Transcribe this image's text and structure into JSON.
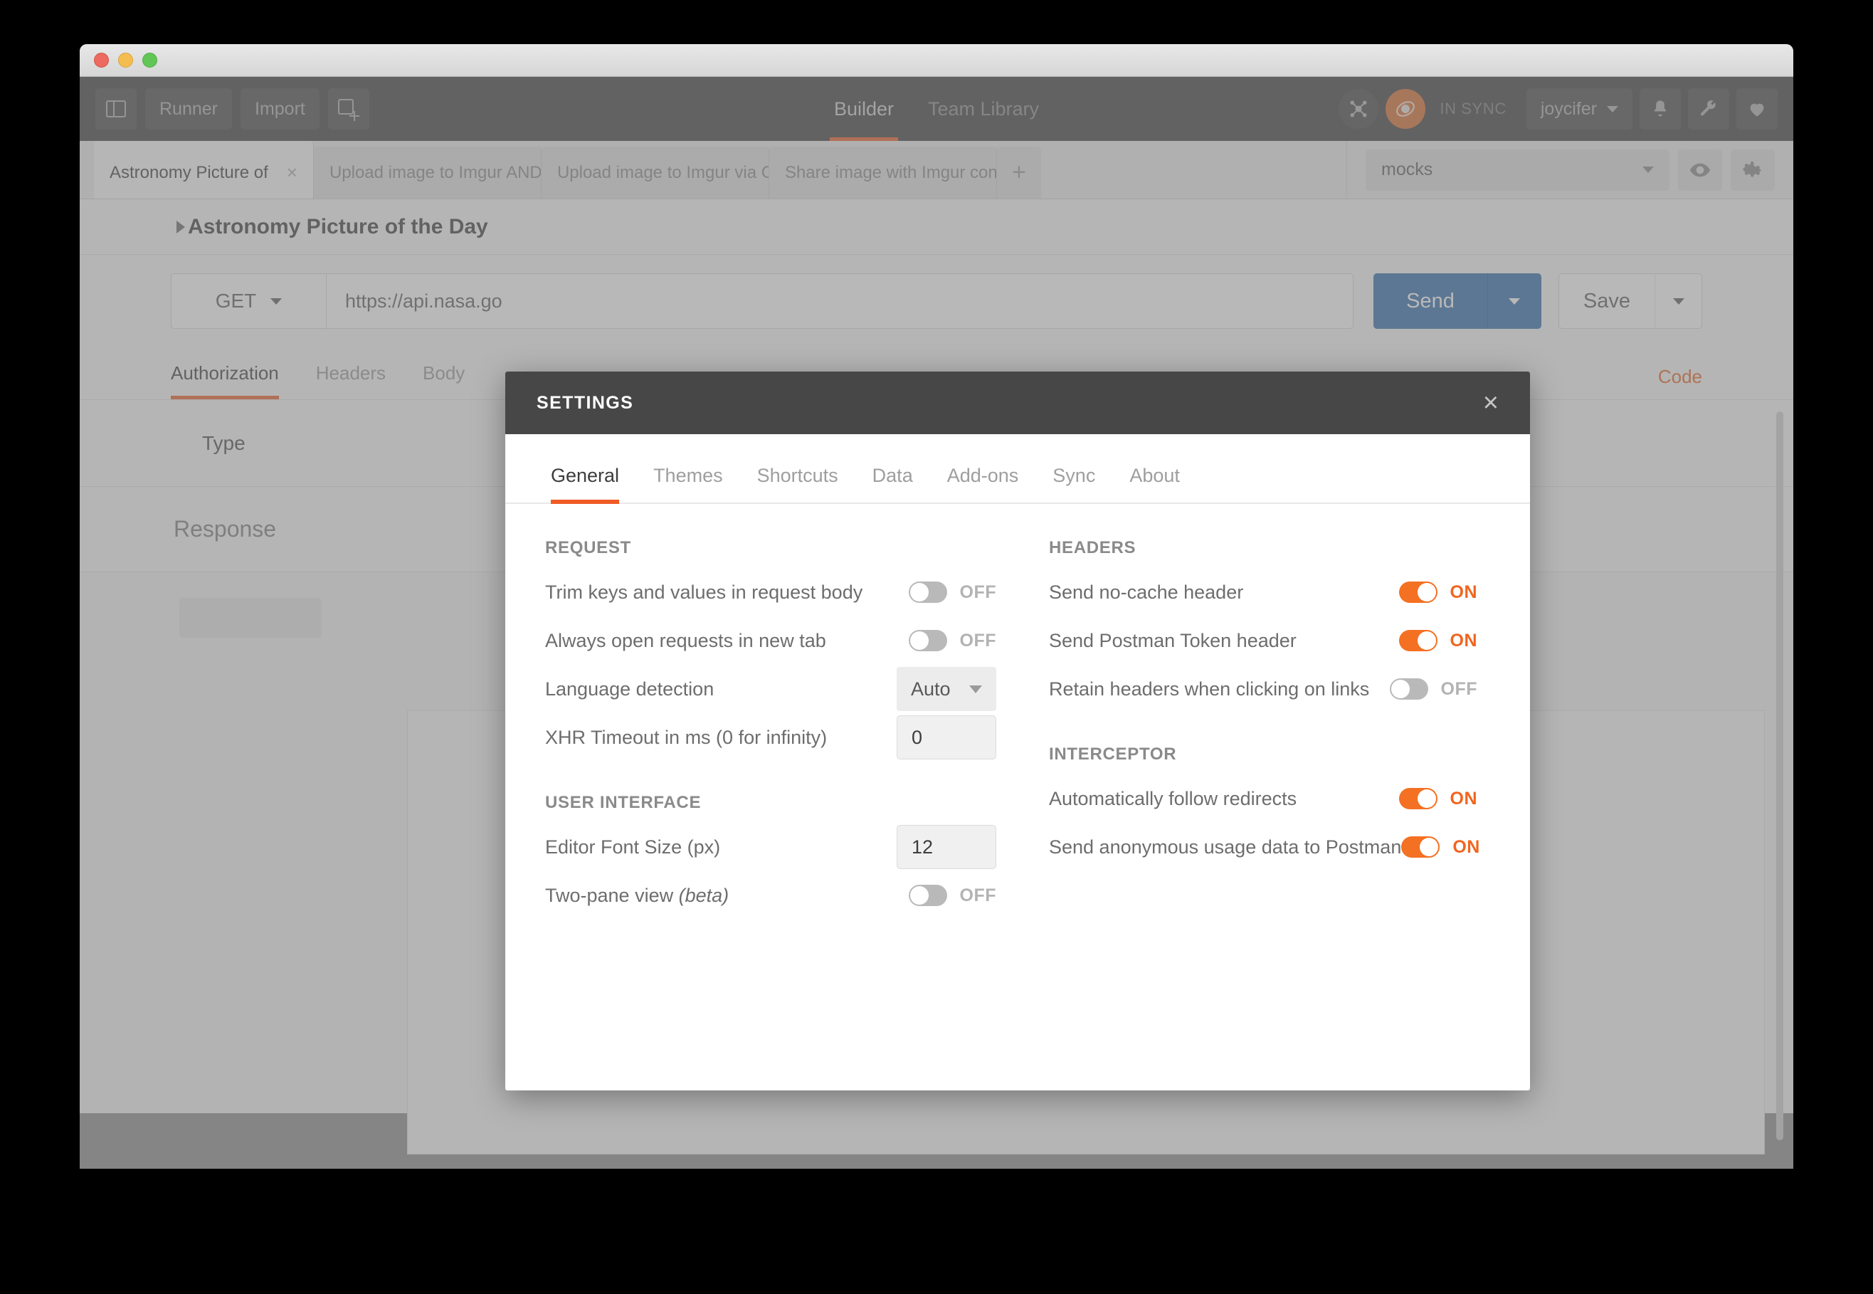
{
  "window": {
    "traffic_lights": [
      "close",
      "minimize",
      "maximize"
    ]
  },
  "topnav": {
    "sidebar_toggle": "sidebar-toggle-icon",
    "runner_label": "Runner",
    "import_label": "Import",
    "new_tab_icon": "new-tab-icon",
    "center_tabs": [
      {
        "label": "Builder",
        "active": true
      },
      {
        "label": "Team Library",
        "active": false
      }
    ],
    "network_icon": "network-icon",
    "sync_icon": "sync-orb-icon",
    "sync_status": "IN SYNC",
    "user_name": "joycifer",
    "bell_icon": "bell-icon",
    "wrench_icon": "wrench-icon",
    "heart_icon": "heart-icon"
  },
  "tabstrip": {
    "tabs": [
      {
        "label": "Astronomy Picture of",
        "active": true,
        "closable": true
      },
      {
        "label": "Upload image to Imgur AND",
        "active": false,
        "closable": false
      },
      {
        "label": "Upload image to Imgur via C",
        "active": false,
        "closable": false
      },
      {
        "label": "Share image with Imgur con",
        "active": false,
        "closable": false
      }
    ],
    "add_tab_label": "+",
    "close_glyph": "×"
  },
  "environment": {
    "selected": "mocks",
    "eye_icon": "eye-icon",
    "gear_icon": "gear-icon"
  },
  "request": {
    "title": "Astronomy Picture of the Day",
    "method": "GET",
    "url": "https://api.nasa.go",
    "send_label": "Send",
    "save_label": "Save",
    "code_link": "Code",
    "subtabs": [
      {
        "label": "Authorization",
        "active": true
      },
      {
        "label": "Headers",
        "active": false
      },
      {
        "label": "Body",
        "active": false
      }
    ],
    "type_label": "Type",
    "response_label": "Response"
  },
  "settings_modal": {
    "title": "SETTINGS",
    "close_glyph": "×",
    "tabs": [
      {
        "label": "General",
        "active": true
      },
      {
        "label": "Themes",
        "active": false
      },
      {
        "label": "Shortcuts",
        "active": false
      },
      {
        "label": "Data",
        "active": false
      },
      {
        "label": "Add-ons",
        "active": false
      },
      {
        "label": "Sync",
        "active": false
      },
      {
        "label": "About",
        "active": false
      }
    ],
    "left_column": {
      "request_group_title": "REQUEST",
      "request_rows": [
        {
          "label": "Trim keys and values in request body",
          "control": "toggle",
          "state": "OFF"
        },
        {
          "label": "Always open requests in new tab",
          "control": "toggle",
          "state": "OFF"
        },
        {
          "label": "Language detection",
          "control": "select",
          "value": "Auto"
        },
        {
          "label": "XHR Timeout in ms (0 for infinity)",
          "control": "number",
          "value": "0"
        }
      ],
      "ui_group_title": "USER INTERFACE",
      "ui_rows": [
        {
          "label": "Editor Font Size (px)",
          "control": "number",
          "value": "12"
        },
        {
          "label": "Two-pane view ",
          "label_beta": "(beta)",
          "control": "toggle",
          "state": "OFF"
        }
      ]
    },
    "right_column": {
      "headers_group_title": "HEADERS",
      "headers_rows": [
        {
          "label": "Send no-cache header",
          "control": "toggle",
          "state": "ON"
        },
        {
          "label": "Send Postman Token header",
          "control": "toggle",
          "state": "ON"
        },
        {
          "label": "Retain headers when clicking on links",
          "control": "toggle",
          "state": "OFF"
        }
      ],
      "interceptor_group_title": "INTERCEPTOR",
      "interceptor_rows": [
        {
          "label": "Automatically follow redirects",
          "control": "toggle",
          "state": "ON"
        },
        {
          "label": "Send anonymous usage data to Postman",
          "control": "toggle",
          "state": "ON"
        }
      ]
    }
  },
  "colors": {
    "accent_orange": "#ef5b25",
    "toggle_on": "#f47022",
    "toggle_off": "#b9b9b9",
    "send_blue": "#2f6bab",
    "modal_header": "#474747",
    "topnav_dark": "#3b3b3b"
  }
}
